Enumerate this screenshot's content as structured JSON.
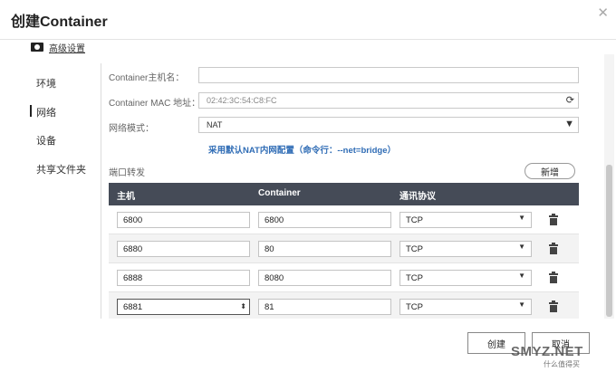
{
  "dialog": {
    "title": "创建Container",
    "close_symbol": "✕"
  },
  "advanced_settings": "高级设置",
  "nav": {
    "items": [
      "环境",
      "网络",
      "设备",
      "共享文件夹"
    ],
    "active_index": 1
  },
  "form": {
    "hostname_label": "Container主机名：",
    "hostname_value": "",
    "mac_label": "Container MAC 地址：",
    "mac_value": "02:42:3C:54:C8:FC",
    "network_mode_label": "网络模式：",
    "network_mode_value": "NAT",
    "hint": "采用默认NAT内网配置（命令行：--net=bridge）"
  },
  "port_forwarding": {
    "label": "端口转发",
    "add_button": "新增",
    "columns": [
      "主机",
      "Container",
      "通讯协议"
    ],
    "rows": [
      {
        "host": "6800",
        "container": "6800",
        "protocol": "TCP"
      },
      {
        "host": "6880",
        "container": "80",
        "protocol": "TCP"
      },
      {
        "host": "6888",
        "container": "8080",
        "protocol": "TCP"
      },
      {
        "host": "6881",
        "container": "81",
        "protocol": "TCP"
      }
    ]
  },
  "buttons": {
    "create": "创建",
    "cancel": "取消"
  },
  "watermark": {
    "main": "SMYZ.NET",
    "sub": "什么值得买"
  },
  "colors": {
    "table_header": "#454b57",
    "hint": "#2f6cb5"
  }
}
